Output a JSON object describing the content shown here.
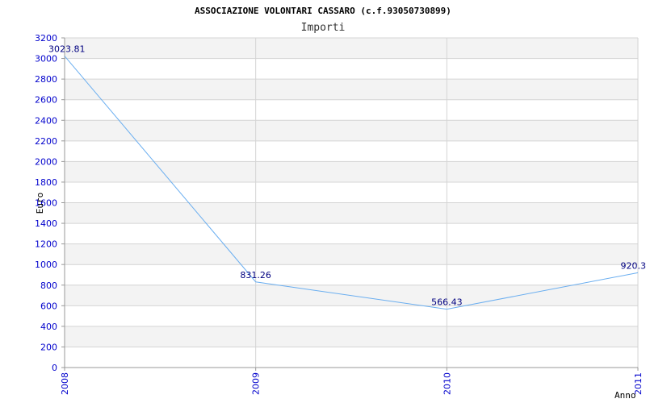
{
  "chart_data": {
    "type": "line",
    "title": "ASSOCIAZIONE VOLONTARI CASSARO (c.f.93050730899)",
    "subtitle": "Importi",
    "xlabel": "Anno",
    "ylabel": "Euro",
    "categories": [
      "2008",
      "2009",
      "2010",
      "2011"
    ],
    "series": [
      {
        "values": [
          3023.81,
          831.26,
          566.43,
          920.3
        ],
        "labels": [
          "3023.81",
          "831.26",
          "566.43",
          "920.3"
        ]
      }
    ],
    "ylim": [
      0,
      3200
    ],
    "yticks": [
      "0",
      "200",
      "400",
      "600",
      "800",
      "1000",
      "1200",
      "1400",
      "1600",
      "1800",
      "2000",
      "2200",
      "2400",
      "2600",
      "2800",
      "3000",
      "3200"
    ],
    "grid": true,
    "legend": "none",
    "colors": {
      "line": "#6aaef0",
      "band": "#f3f3f3",
      "grid": "#d4d4d4",
      "tick_text": "#0000cc",
      "data_label": "#000080"
    }
  }
}
